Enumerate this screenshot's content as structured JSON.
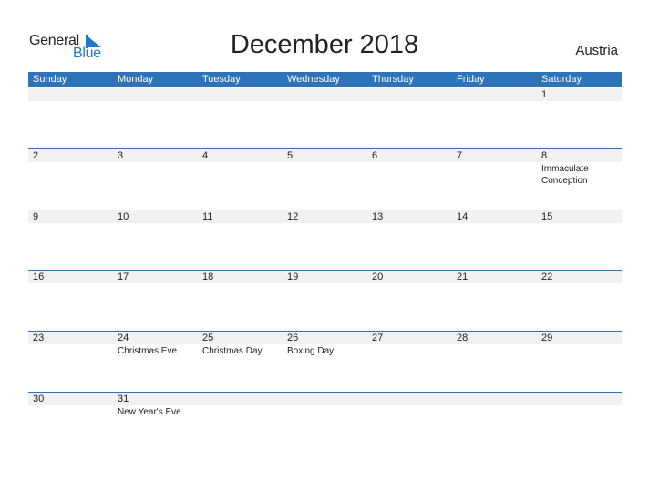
{
  "logo": {
    "general": "General",
    "blue": "Blue"
  },
  "title": "December 2018",
  "country": "Austria",
  "weekdays": [
    "Sunday",
    "Monday",
    "Tuesday",
    "Wednesday",
    "Thursday",
    "Friday",
    "Saturday"
  ],
  "weeks": [
    [
      {
        "d": ""
      },
      {
        "d": ""
      },
      {
        "d": ""
      },
      {
        "d": ""
      },
      {
        "d": ""
      },
      {
        "d": ""
      },
      {
        "d": "1"
      }
    ],
    [
      {
        "d": "2"
      },
      {
        "d": "3"
      },
      {
        "d": "4"
      },
      {
        "d": "5"
      },
      {
        "d": "6"
      },
      {
        "d": "7"
      },
      {
        "d": "8",
        "e": "Immaculate Conception"
      }
    ],
    [
      {
        "d": "9"
      },
      {
        "d": "10"
      },
      {
        "d": "11"
      },
      {
        "d": "12"
      },
      {
        "d": "13"
      },
      {
        "d": "14"
      },
      {
        "d": "15"
      }
    ],
    [
      {
        "d": "16"
      },
      {
        "d": "17"
      },
      {
        "d": "18"
      },
      {
        "d": "19"
      },
      {
        "d": "20"
      },
      {
        "d": "21"
      },
      {
        "d": "22"
      }
    ],
    [
      {
        "d": "23"
      },
      {
        "d": "24",
        "e": "Christmas Eve"
      },
      {
        "d": "25",
        "e": "Christmas Day"
      },
      {
        "d": "26",
        "e": "Boxing Day"
      },
      {
        "d": "27"
      },
      {
        "d": "28"
      },
      {
        "d": "29"
      }
    ],
    [
      {
        "d": "30"
      },
      {
        "d": "31",
        "e": "New Year's Eve"
      },
      {
        "d": ""
      },
      {
        "d": ""
      },
      {
        "d": ""
      },
      {
        "d": ""
      },
      {
        "d": ""
      }
    ]
  ],
  "colors": {
    "header": "#2e73b8",
    "brand_blue": "#1f78c8",
    "date_strip": "#f1f1f1"
  }
}
